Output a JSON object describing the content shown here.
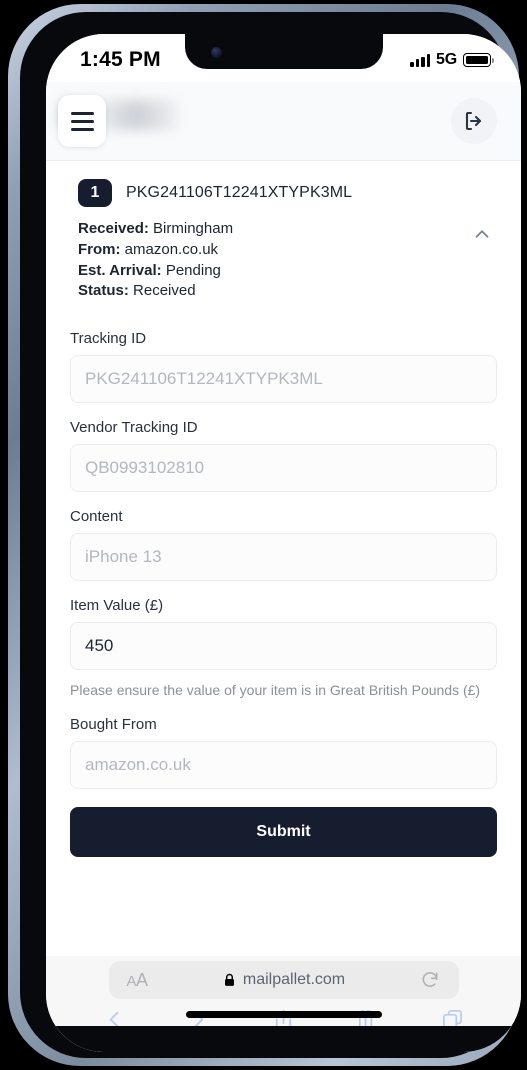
{
  "status_bar": {
    "time": "1:45 PM",
    "network": "5G",
    "signal_icon": "signal-bars-icon",
    "battery_icon": "battery-full-icon"
  },
  "header": {
    "menu_icon": "hamburger-menu-icon",
    "logout_icon": "logout-icon"
  },
  "package": {
    "badge": "1",
    "tracking_code": "PKG241106T12241XTYPK3ML",
    "collapse_icon": "chevron-up-icon",
    "meta": [
      {
        "label": "Received:",
        "value": "Birmingham"
      },
      {
        "label": "From:",
        "value": "amazon.co.uk"
      },
      {
        "label": "Est. Arrival:",
        "value": "Pending"
      },
      {
        "label": "Status:",
        "value": "Received"
      }
    ]
  },
  "form": {
    "fields": [
      {
        "label": "Tracking ID",
        "placeholder": "PKG241106T12241XTYPK3ML",
        "value": ""
      },
      {
        "label": "Vendor Tracking ID",
        "placeholder": "QB0993102810",
        "value": ""
      },
      {
        "label": "Content",
        "placeholder": "iPhone 13",
        "value": ""
      },
      {
        "label": "Item Value (£)",
        "placeholder": "",
        "value": "450"
      },
      {
        "label": "Bought From",
        "placeholder": "amazon.co.uk",
        "value": ""
      }
    ],
    "value_hint": "Please ensure the value of your item is in Great British Pounds (£)",
    "submit_label": "Submit"
  },
  "browser": {
    "text_size_icon": "text-size-aa-icon",
    "lock_icon": "lock-icon",
    "domain": "mailpallet.com",
    "reload_icon": "reload-icon",
    "back_icon": "chevron-left-icon",
    "forward_icon": "chevron-right-icon",
    "share_icon": "share-icon",
    "bookmarks_icon": "book-icon",
    "tabs_icon": "tabs-icon"
  },
  "colors": {
    "dark_navy": "#161d2e",
    "header_bg": "#f9fafb",
    "input_border": "#e9ebef",
    "placeholder": "#b3b7be",
    "hint_text": "#8b9098",
    "safari_link": "#b9cdf0"
  }
}
